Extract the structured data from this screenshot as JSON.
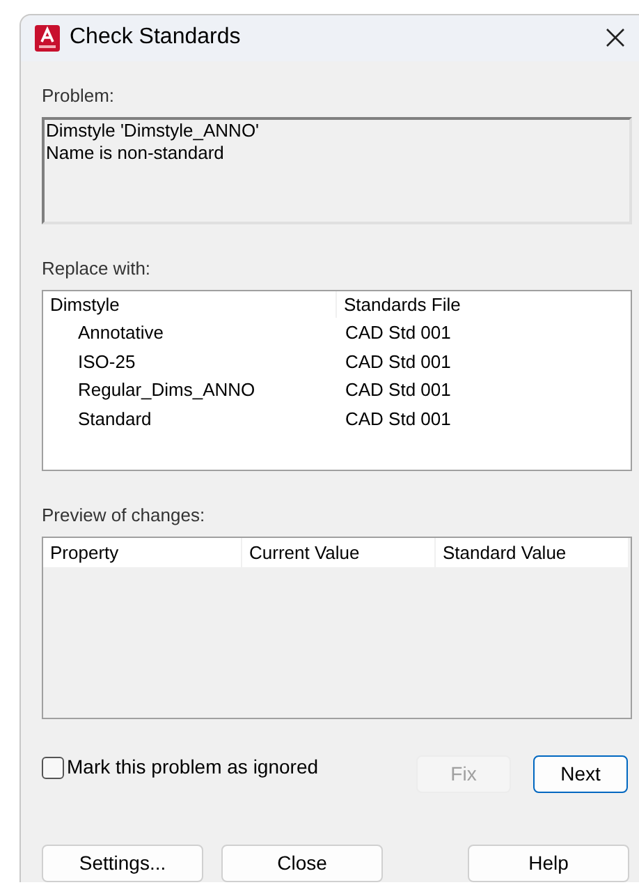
{
  "window": {
    "title": "Check Standards"
  },
  "problem": {
    "label": "Problem:",
    "lines": [
      "Dimstyle 'Dimstyle_ANNO'",
      "Name is non-standard"
    ]
  },
  "replace_with": {
    "label": "Replace with:",
    "columns": [
      "Dimstyle",
      "Standards File"
    ],
    "rows": [
      {
        "name": "Annotative",
        "file": "CAD Std 001"
      },
      {
        "name": "ISO-25",
        "file": "CAD Std 001"
      },
      {
        "name": "Regular_Dims_ANNO",
        "file": "CAD Std 001"
      },
      {
        "name": "Standard",
        "file": "CAD Std 001"
      }
    ]
  },
  "preview": {
    "label": "Preview of changes:",
    "columns": [
      "Property",
      "Current Value",
      "Standard Value"
    ]
  },
  "ignore_checkbox": {
    "label": "Mark this problem as ignored",
    "checked": false
  },
  "action_buttons": [
    {
      "label": "Fix",
      "disabled": true,
      "default": false
    },
    {
      "label": "Next",
      "disabled": false,
      "default": true
    }
  ],
  "bottom_buttons": [
    {
      "label": "Settings...",
      "disabled": false,
      "default": false
    },
    {
      "label": "Close",
      "disabled": false,
      "default": false
    },
    {
      "label": "Help",
      "disabled": false,
      "default": false
    }
  ]
}
